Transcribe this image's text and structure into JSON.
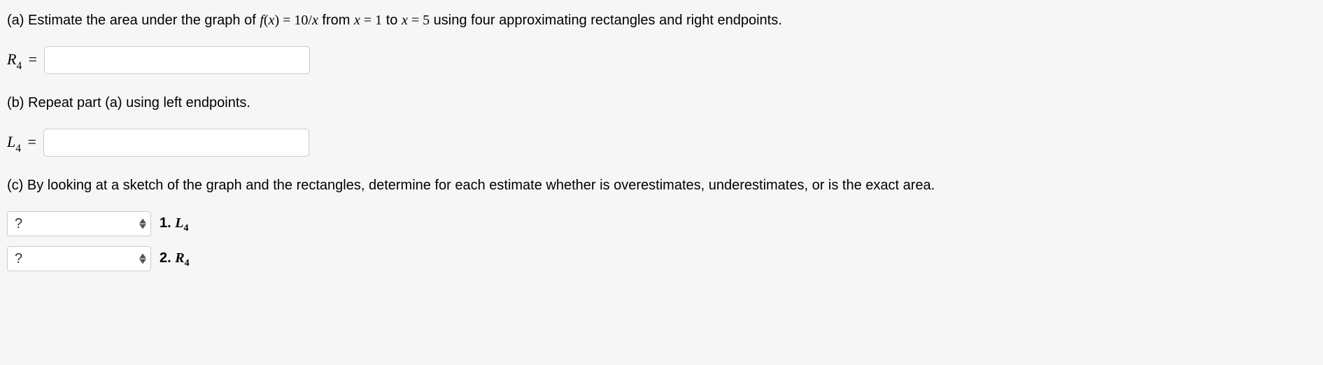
{
  "partA": {
    "pre": "(a) Estimate the area under the graph of ",
    "fn_letter": "f",
    "fn_arg_open": "(",
    "fn_var": "x",
    "fn_arg_close": ")",
    "eq": " = ",
    "rhs_num": "10/",
    "rhs_var": "x",
    "from_txt": " from ",
    "var1": "x",
    "eq1": " = 1",
    "to_txt": " to ",
    "var2": "x",
    "eq2": " = 5",
    "post": " using four approximating rectangles and right endpoints."
  },
  "inputA": {
    "label_letter": "R",
    "label_sub": "4",
    "label_eq": " = ",
    "value": ""
  },
  "partB": {
    "text": "(b) Repeat part (a) using left endpoints."
  },
  "inputB": {
    "label_letter": "L",
    "label_sub": "4",
    "label_eq": " = ",
    "value": ""
  },
  "partC": {
    "text": "(c) By looking at a sketch of the graph and the rectangles, determine for each estimate whether is overestimates, underestimates, or is the exact area."
  },
  "match1": {
    "select_display": "?",
    "num": "1. ",
    "letter": "L",
    "sub": "4"
  },
  "match2": {
    "select_display": "?",
    "num": "2. ",
    "letter": "R",
    "sub": "4"
  }
}
